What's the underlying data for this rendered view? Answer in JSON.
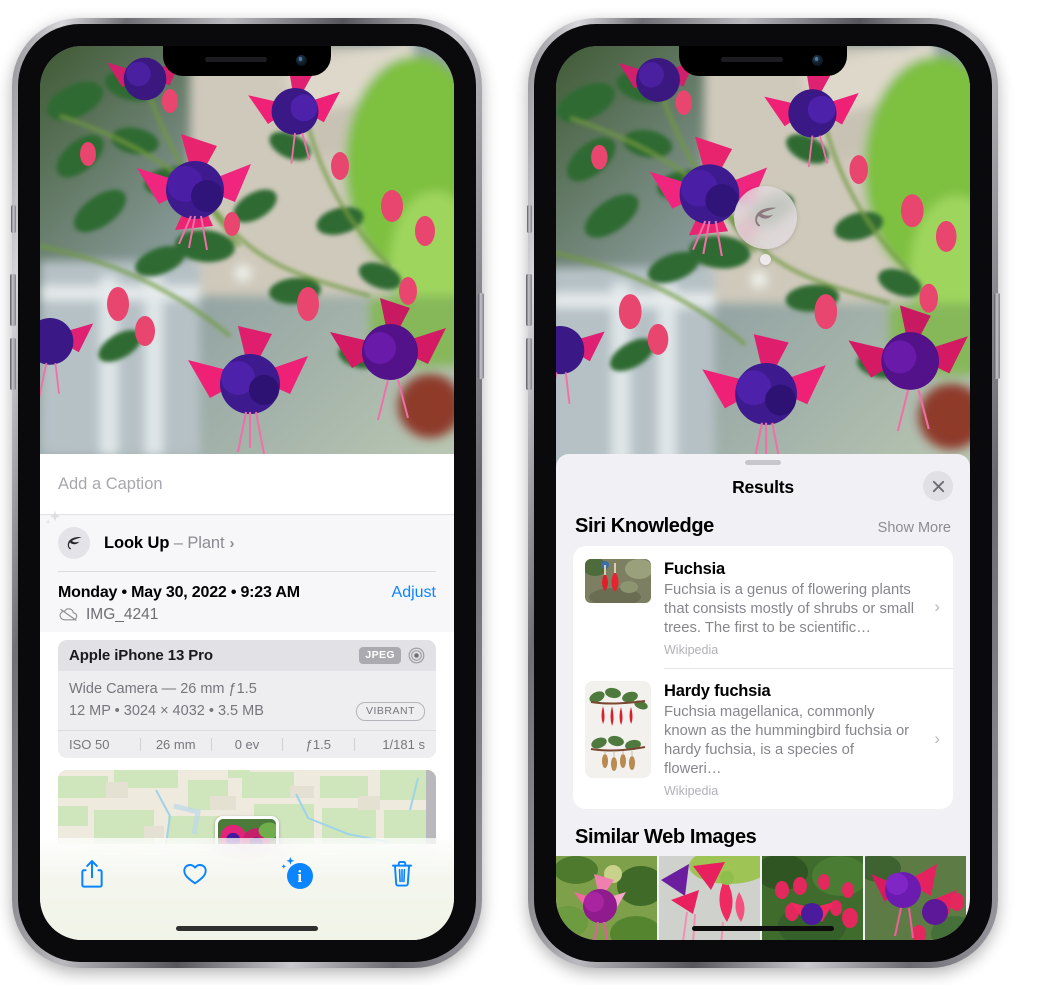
{
  "left_phone": {
    "caption_placeholder": "Add a Caption",
    "lookup": {
      "label": "Look Up",
      "dash": " – ",
      "subject": "Plant",
      "chevron": "›",
      "icon": "leaf-icon"
    },
    "date_line": "Monday • May 30, 2022 • 9:23 AM",
    "adjust_label": "Adjust",
    "filename": "IMG_4241",
    "filename_icon": "no-icloud-icon",
    "exif": {
      "device": "Apple iPhone 13 Pro",
      "format_badge": "JPEG",
      "hdr_icon": "hdr-target-icon",
      "lens_line": "Wide Camera — 26 mm ƒ1.5",
      "size_line": "12 MP • 3024 × 4032 • 3.5 MB",
      "style_badge": "VIBRANT",
      "stats": [
        "ISO 50",
        "26 mm",
        "0 ev",
        "ƒ1.5",
        "1/181 s"
      ]
    },
    "toolbar": [
      {
        "name": "share-button",
        "icon": "share-icon"
      },
      {
        "name": "favorite-button",
        "icon": "heart-icon"
      },
      {
        "name": "info-button",
        "icon": "info-sparkle-icon",
        "active": true
      },
      {
        "name": "delete-button",
        "icon": "trash-icon"
      }
    ],
    "accent_color": "#0a84ff"
  },
  "right_phone": {
    "visual_lookup_badge": "leaf-icon",
    "sheet": {
      "title": "Results",
      "close_icon": "close-icon",
      "sections": [
        {
          "title": "Siri Knowledge",
          "action": "Show More",
          "cards": [
            {
              "title": "Fuchsia",
              "description": "Fuchsia is a genus of flowering plants that consists mostly of shrubs or small trees. The first to be scientific…",
              "source": "Wikipedia",
              "chevron": "›"
            },
            {
              "title": "Hardy fuchsia",
              "description": "Fuchsia magellanica, commonly known as the hummingbird fuchsia or hardy fuchsia, is a species of floweri…",
              "source": "Wikipedia",
              "chevron": "›"
            }
          ]
        },
        {
          "title": "Similar Web Images",
          "thumbnails": 4
        }
      ]
    }
  }
}
